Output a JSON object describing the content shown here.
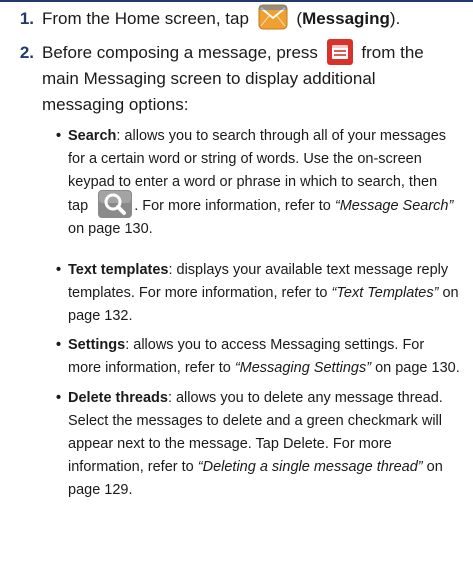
{
  "steps": [
    {
      "number": "1.",
      "before": "From the Home screen, tap",
      "icon": "messaging-envelope-icon",
      "after_open": "(",
      "bold": "Messaging",
      "after_close": ")."
    },
    {
      "number": "2.",
      "before": "Before composing a message, press",
      "icon": "menu-key-icon",
      "after": "from the main Messaging screen to display additional messaging options:"
    }
  ],
  "bullets": [
    {
      "term": "Search",
      "text1": ": allows you to search through all of your messages for a certain word or string of words. Use the on-screen keypad to enter a word or phrase in which to search, then tap",
      "icon": "search-icon",
      "text2": ". For more information, refer to",
      "ref": "“Message Search”",
      "text3": "on page 130."
    },
    {
      "term": "Text templates",
      "text1": ": displays your available text message reply templates. For more information, refer to",
      "ref": "“Text Templates”",
      "text2": "on page 132."
    },
    {
      "term": "Settings",
      "text1": ": allows you to access Messaging settings. For more information, refer to",
      "ref": "“Messaging Settings”",
      "text2": "on page 130."
    },
    {
      "term": "Delete threads",
      "text1": ": allows you to delete any message thread. Select the messages to delete and a green checkmark will appear next to the message. Tap Delete. For more information, refer to",
      "ref": "“Deleting a single message thread”",
      "text2": "on page 129."
    }
  ],
  "colors": {
    "heading": "#1f3a6b",
    "envelope_orange": "#f0a030",
    "envelope_blue": "#4a7fc0",
    "menu_red": "#d8322a",
    "search_gray": "#8a8a8a"
  }
}
